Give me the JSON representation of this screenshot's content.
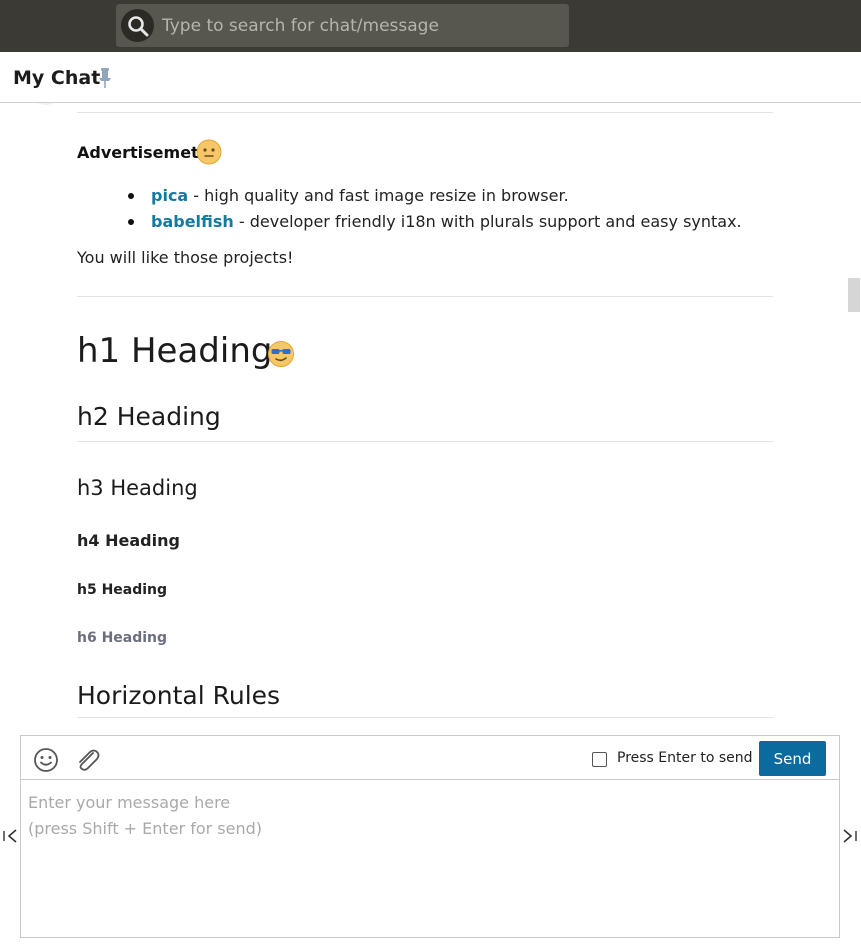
{
  "search": {
    "placeholder": "Type to search for chat/message",
    "icon": "search-icon"
  },
  "header": {
    "title": "My Chat",
    "pin_icon": "pin-icon"
  },
  "message": {
    "advert_title": "Advertisemet",
    "advert_emoji": "slightly-smiling-face-icon",
    "advert_items": [
      {
        "link": "pica",
        "text": " - high quality and fast image resize in browser."
      },
      {
        "link": "babelfish",
        "text": " - developer friendly i18n with plurals support and easy syntax."
      }
    ],
    "advert_note": "You will like those projects!",
    "h1": "h1 Heading",
    "h1_emoji": "sunglasses-face-icon",
    "h2": "h2 Heading",
    "h3": "h3 Heading",
    "h4": "h4 Heading",
    "h5": "h5 Heading",
    "h6": "h6 Heading",
    "section": "Horizontal Rules"
  },
  "composer": {
    "emoji_icon": "smiley-icon",
    "attach_icon": "paperclip-icon",
    "enter_to_send_label": "Press Enter to send",
    "enter_to_send_checked": false,
    "send_label": "Send",
    "placeholder": "Enter your message here\n(press Shift + Enter for send)"
  },
  "nav": {
    "prev_icon": "first-page-icon",
    "next_icon": "last-page-icon"
  },
  "colors": {
    "topbar": "#3b3a34",
    "link": "#137aa0",
    "send_button": "#0b6a9e",
    "h6": "#6b6f7e"
  }
}
